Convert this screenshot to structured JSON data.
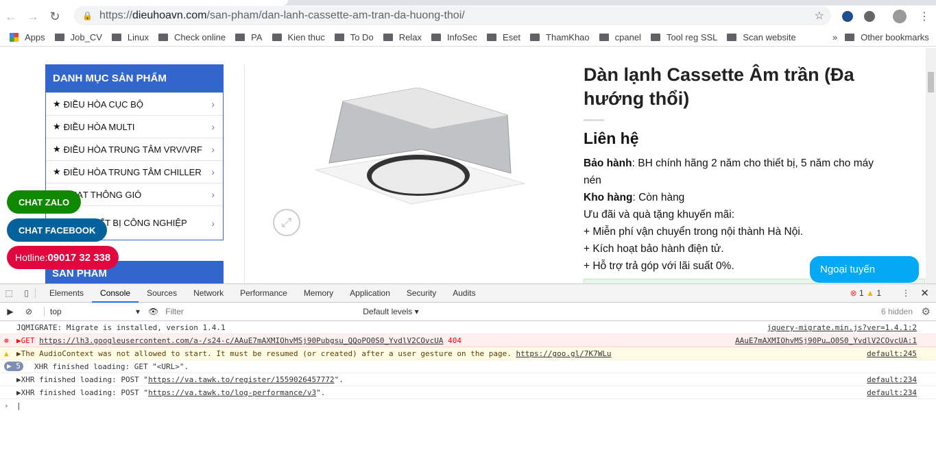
{
  "browser": {
    "url_prefix": "https://",
    "url_domain": "dieuhoavn.com",
    "url_path": "/san-pham/dan-lanh-cassette-am-tran-da-huong-thoi/"
  },
  "bookmarks": [
    "Apps",
    "Job_CV",
    "Linux",
    "Check online",
    "PA",
    "Kien thuc",
    "To Do",
    "Relax",
    "InfoSec",
    "Eset",
    "ThamKhao",
    "cpanel",
    "Tool reg SSL",
    "Scan website"
  ],
  "other_bookmarks": "Other bookmarks",
  "sidebar": {
    "title": "DANH MỤC SẢN PHẨM",
    "items": [
      "ĐIỀU HÒA CỤC BỘ",
      "ĐIỀU HÒA MULTI",
      "ĐIỀU HÒA TRUNG TÂM VRV/VRF",
      "ĐIỀU HÒA TRUNG TÂM CHILLER",
      "QUẠT THÔNG GIÓ",
      "CÁC THIẾT BỊ CÔNG NGHIỆP"
    ],
    "products_title": "SẢN PHẨM"
  },
  "product": {
    "title": "Dàn lạnh Cassette Âm trần (Đa hướng thổi)",
    "price": "Liên hệ",
    "warranty_label": "Bảo hành",
    "warranty": ": BH chính hãng 2 năm cho thiết bị, 5 năm cho máy nén",
    "stock_label": "Kho hàng",
    "stock": ": Còn hàng",
    "offers": [
      "Ưu đãi và quà tặng khuyến mãi:",
      "+ Miễn phí vận chuyển trong nội thành Hà Nội.",
      "+ Kích hoạt bảo hành điện tử.",
      "+ Hỗ trợ trả góp với lãi suất 0%."
    ]
  },
  "floating": {
    "zalo": "CHAT ZALO",
    "facebook": "CHAT FACEBOOK",
    "hotline_label": "Hotline: ",
    "hotline": "09017 32 338",
    "offline": "Ngoại tuyến"
  },
  "colors": {
    "zalo": "#0f8a00",
    "facebook": "#03619c",
    "hotline": "#e2063f",
    "sidebar": "#3366cc",
    "offline": "#03a9f4"
  },
  "devtools": {
    "tabs": [
      "Elements",
      "Console",
      "Sources",
      "Network",
      "Performance",
      "Memory",
      "Application",
      "Security",
      "Audits"
    ],
    "active_tab": "Console",
    "errors": "1",
    "warnings": "1",
    "context": "top",
    "filter_placeholder": "Filter",
    "levels": "Default levels ▾",
    "hidden": "6 hidden",
    "messages": [
      {
        "type": "log",
        "text": "JQMIGRATE: Migrate is installed, version 1.4.1",
        "source": "jquery-migrate.min.js?ver=1.4.1:2"
      },
      {
        "type": "error",
        "prefix": "▶GET ",
        "link": "https://lh3.googleusercontent.com/a-/s24-c/AAuE7mAXMIOhvMSj90Pubgsu_QQoPO0S0_YvdlV2COvcUA",
        "suffix": " 404",
        "source": "AAuE7mAXMIOhvMSj90Pu…O0S0_YvdlV2COvcUA:1"
      },
      {
        "type": "warn",
        "prefix": "▶The AudioContext was not allowed to start. It must be resumed (or created) after a user gesture on the page. ",
        "link": "https://goo.gl/7K7WLu",
        "source": "default:245"
      },
      {
        "type": "group",
        "count": "5",
        "text": "XHR finished loading: GET \"<URL>\"."
      },
      {
        "type": "log",
        "prefix": "▶XHR finished loading: POST \"",
        "link": "https://va.tawk.to/register/1559026457772",
        "suffix": "\".",
        "source": "default:234"
      },
      {
        "type": "log",
        "prefix": "▶XHR finished loading: POST \"",
        "link": "https://va.tawk.to/log-performance/v3",
        "suffix": "\".",
        "source": "default:234"
      }
    ]
  }
}
